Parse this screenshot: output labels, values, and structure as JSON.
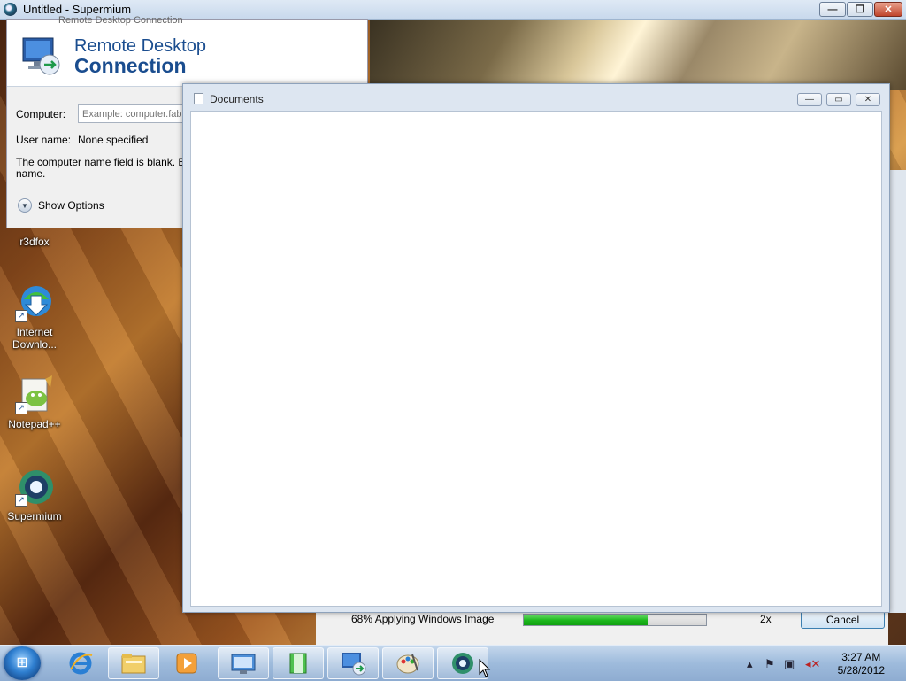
{
  "app_window": {
    "title": "Untitled - Supermium"
  },
  "rdc": {
    "ghost_title": "Remote Desktop Connection",
    "logo_line1": "Remote Desktop",
    "logo_line2": "Connection",
    "computer_label": "Computer:",
    "computer_placeholder": "Example: computer.fabrikam.com",
    "username_label": "User name:",
    "username_value": "None specified",
    "message": "The computer name field is blank. Enter a full remote computer name.",
    "message_line1": "The computer name field is blank. Enter",
    "message_line2": "name.",
    "show_options": "Show Options"
  },
  "desktop_icons": [
    {
      "label": "r3dfox"
    },
    {
      "label": "Internet\nDownlo..."
    },
    {
      "label": "Notepad++"
    },
    {
      "label": "Supermium"
    }
  ],
  "documents_window": {
    "title": "Documents"
  },
  "progress": {
    "status": "68% Applying Windows Image",
    "percent": 68,
    "speed": "2x",
    "cancel": "Cancel"
  },
  "clock": {
    "time": "3:27 AM",
    "date": "5/28/2012"
  },
  "colors": {
    "progress_fill": "#1cb61c",
    "rdc_brand": "#1a4d8f"
  }
}
